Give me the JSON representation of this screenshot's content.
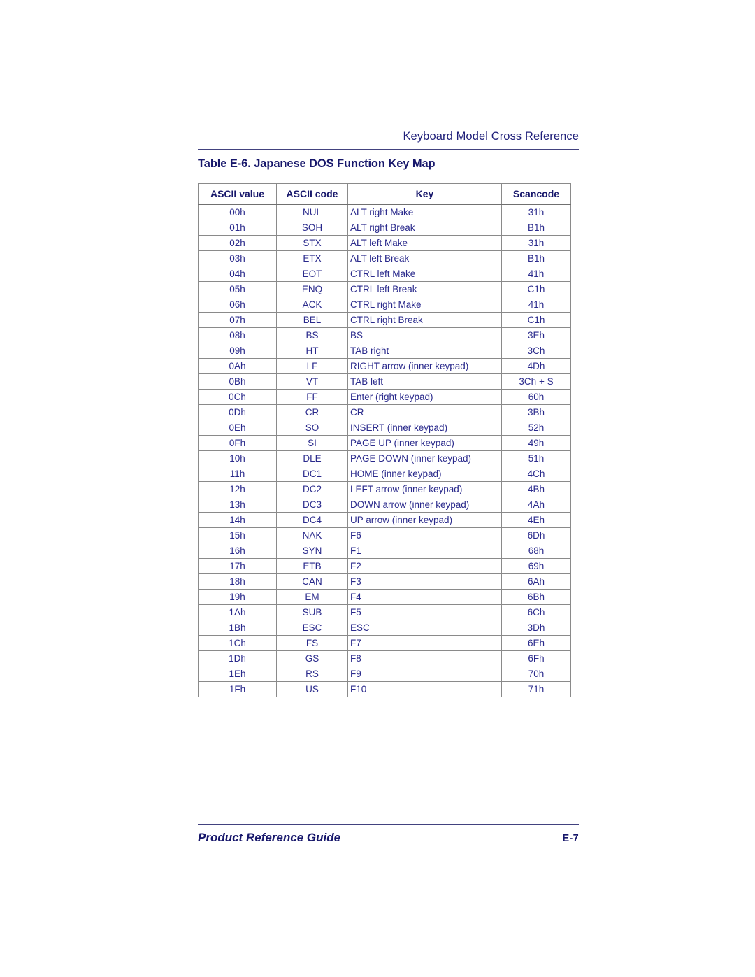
{
  "page": {
    "running_head": "Keyboard Model Cross Reference",
    "caption": "Table E-6. Japanese DOS Function Key Map",
    "footer_title": "Product Reference Guide",
    "page_number": "E-7",
    "text_color": "#2a2a8c",
    "heading_color": "#17176b",
    "rule_color": "#42427f",
    "table_border_color": "#8a8a8a"
  },
  "table": {
    "columns": [
      "ASCII value",
      "ASCII code",
      "Key",
      "Scancode"
    ],
    "rows": [
      [
        "00h",
        "NUL",
        "ALT right Make",
        "31h"
      ],
      [
        "01h",
        "SOH",
        "ALT right Break",
        "B1h"
      ],
      [
        "02h",
        "STX",
        "ALT left Make",
        "31h"
      ],
      [
        "03h",
        "ETX",
        "ALT left Break",
        "B1h"
      ],
      [
        "04h",
        "EOT",
        "CTRL left Make",
        "41h"
      ],
      [
        "05h",
        "ENQ",
        "CTRL left Break",
        "C1h"
      ],
      [
        "06h",
        "ACK",
        "CTRL right Make",
        "41h"
      ],
      [
        "07h",
        "BEL",
        "CTRL right Break",
        "C1h"
      ],
      [
        "08h",
        "BS",
        "BS",
        "3Eh"
      ],
      [
        "09h",
        "HT",
        "TAB right",
        "3Ch"
      ],
      [
        "0Ah",
        "LF",
        "RIGHT arrow (inner keypad)",
        "4Dh"
      ],
      [
        "0Bh",
        "VT",
        "TAB left",
        "3Ch + S"
      ],
      [
        "0Ch",
        "FF",
        "Enter (right keypad)",
        "60h"
      ],
      [
        "0Dh",
        "CR",
        "CR",
        "3Bh"
      ],
      [
        "0Eh",
        "SO",
        "INSERT (inner keypad)",
        "52h"
      ],
      [
        "0Fh",
        "SI",
        "PAGE UP (inner keypad)",
        "49h"
      ],
      [
        "10h",
        "DLE",
        "PAGE DOWN (inner keypad)",
        "51h"
      ],
      [
        "11h",
        "DC1",
        "HOME (inner keypad)",
        "4Ch"
      ],
      [
        "12h",
        "DC2",
        "LEFT arrow (inner keypad)",
        "4Bh"
      ],
      [
        "13h",
        "DC3",
        "DOWN arrow (inner keypad)",
        "4Ah"
      ],
      [
        "14h",
        "DC4",
        "UP arrow (inner keypad)",
        "4Eh"
      ],
      [
        "15h",
        "NAK",
        "F6",
        "6Dh"
      ],
      [
        "16h",
        "SYN",
        "F1",
        "68h"
      ],
      [
        "17h",
        "ETB",
        "F2",
        "69h"
      ],
      [
        "18h",
        "CAN",
        "F3",
        "6Ah"
      ],
      [
        "19h",
        "EM",
        "F4",
        "6Bh"
      ],
      [
        "1Ah",
        "SUB",
        "F5",
        "6Ch"
      ],
      [
        "1Bh",
        "ESC",
        "ESC",
        "3Dh"
      ],
      [
        "1Ch",
        "FS",
        "F7",
        "6Eh"
      ],
      [
        "1Dh",
        "GS",
        "F8",
        "6Fh"
      ],
      [
        "1Eh",
        "RS",
        "F9",
        "70h"
      ],
      [
        "1Fh",
        "US",
        "F10",
        "71h"
      ]
    ]
  }
}
